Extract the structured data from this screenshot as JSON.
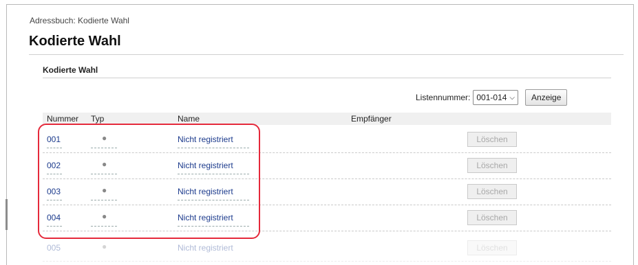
{
  "breadcrumb": "Adressbuch: Kodierte Wahl",
  "page_title": "Kodierte Wahl",
  "section_title": "Kodierte Wahl",
  "toolbar": {
    "list_label": "Listennummer:",
    "list_value": "001-014",
    "display_button": "Anzeige"
  },
  "table": {
    "headers": {
      "number": "Nummer",
      "type": "Typ",
      "name": "Name",
      "recipient": "Empfänger"
    },
    "rows": [
      {
        "number": "001",
        "type": "●",
        "name": "Nicht registriert",
        "delete": "Löschen"
      },
      {
        "number": "002",
        "type": "●",
        "name": "Nicht registriert",
        "delete": "Löschen"
      },
      {
        "number": "003",
        "type": "●",
        "name": "Nicht registriert",
        "delete": "Löschen"
      },
      {
        "number": "004",
        "type": "●",
        "name": "Nicht registriert",
        "delete": "Löschen"
      },
      {
        "number": "005",
        "type": "●",
        "name": "Nicht registriert",
        "delete": "Löschen"
      }
    ]
  },
  "colors": {
    "highlight": "#e5283a",
    "link": "#1b3a8c"
  }
}
